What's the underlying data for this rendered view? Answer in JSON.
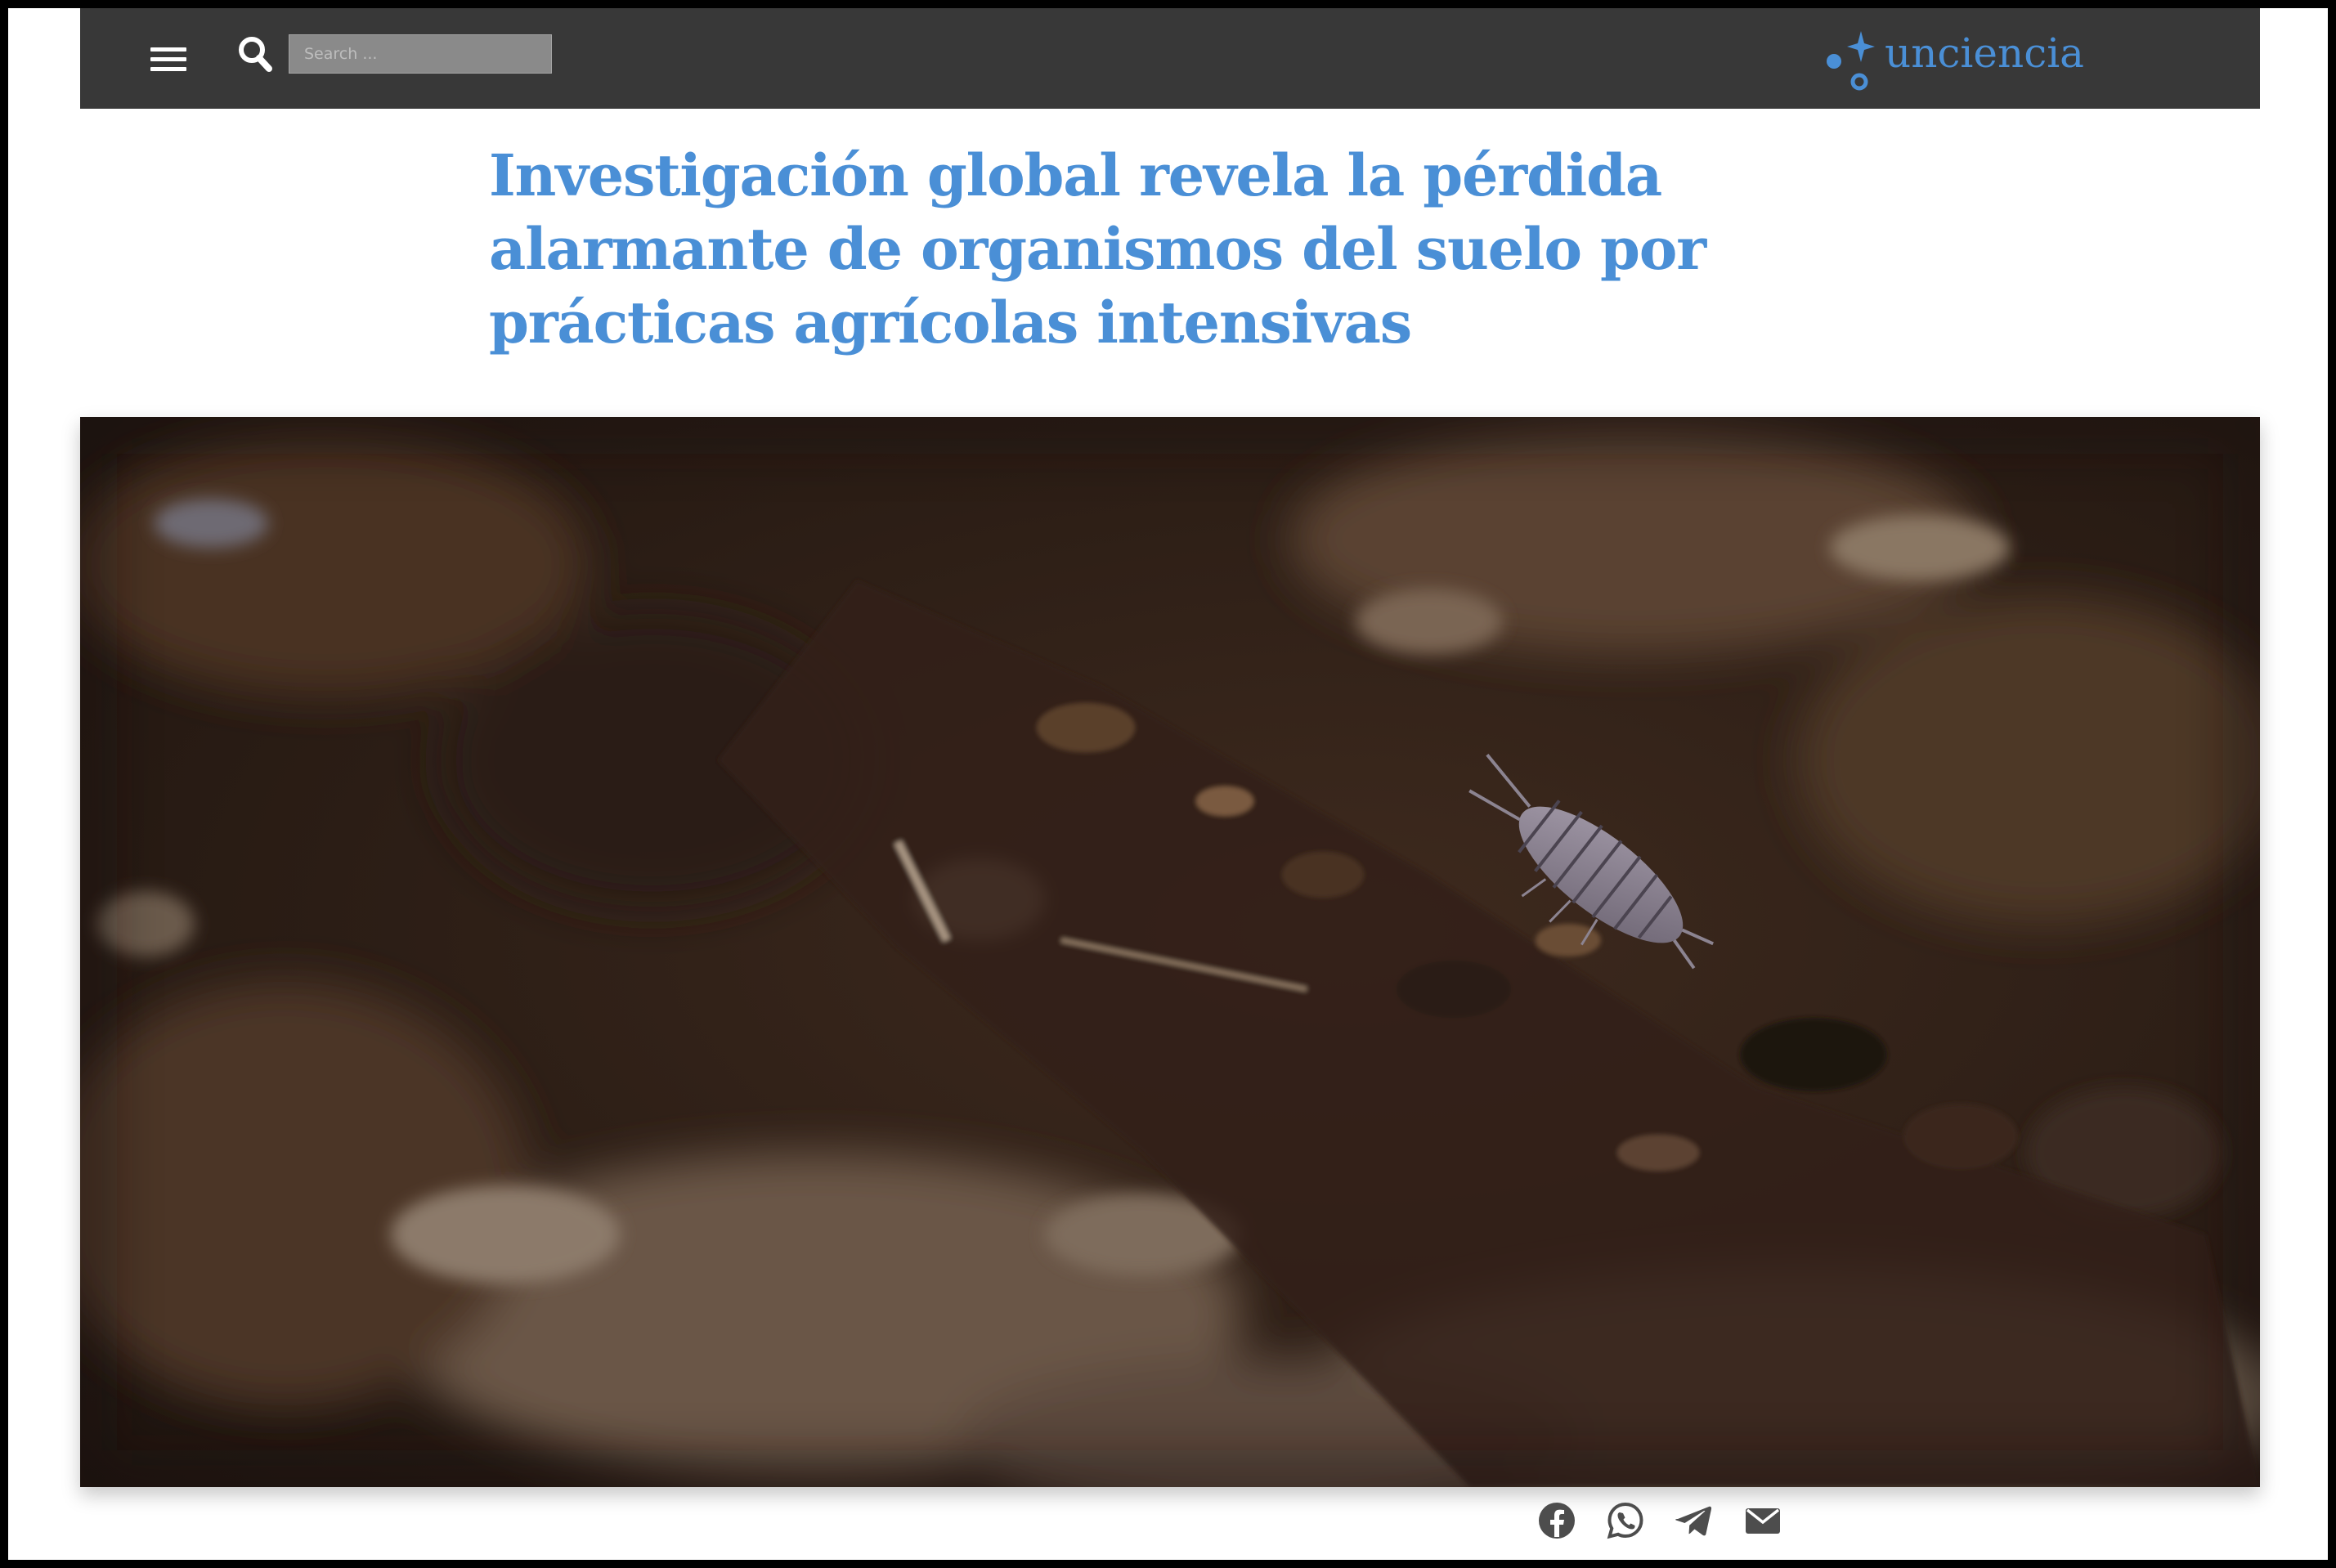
{
  "header": {
    "menu_icon": "hamburger-menu-icon",
    "search_icon": "magnifier-icon",
    "search_placeholder": "Search ..."
  },
  "brand": {
    "name": "unciencia",
    "accent_color": "#4a8fd6",
    "header_bg": "#383838"
  },
  "article": {
    "title_lines": [
      "Investigación global revela la pérdida",
      "alarmante de organismos del suelo por",
      "prácticas agrícolas intensivas"
    ],
    "hero_image": "close-up of dark soil with a small grey woodlouse"
  },
  "share": {
    "icons": [
      "facebook-icon",
      "whatsapp-icon",
      "telegram-icon",
      "email-icon"
    ]
  }
}
